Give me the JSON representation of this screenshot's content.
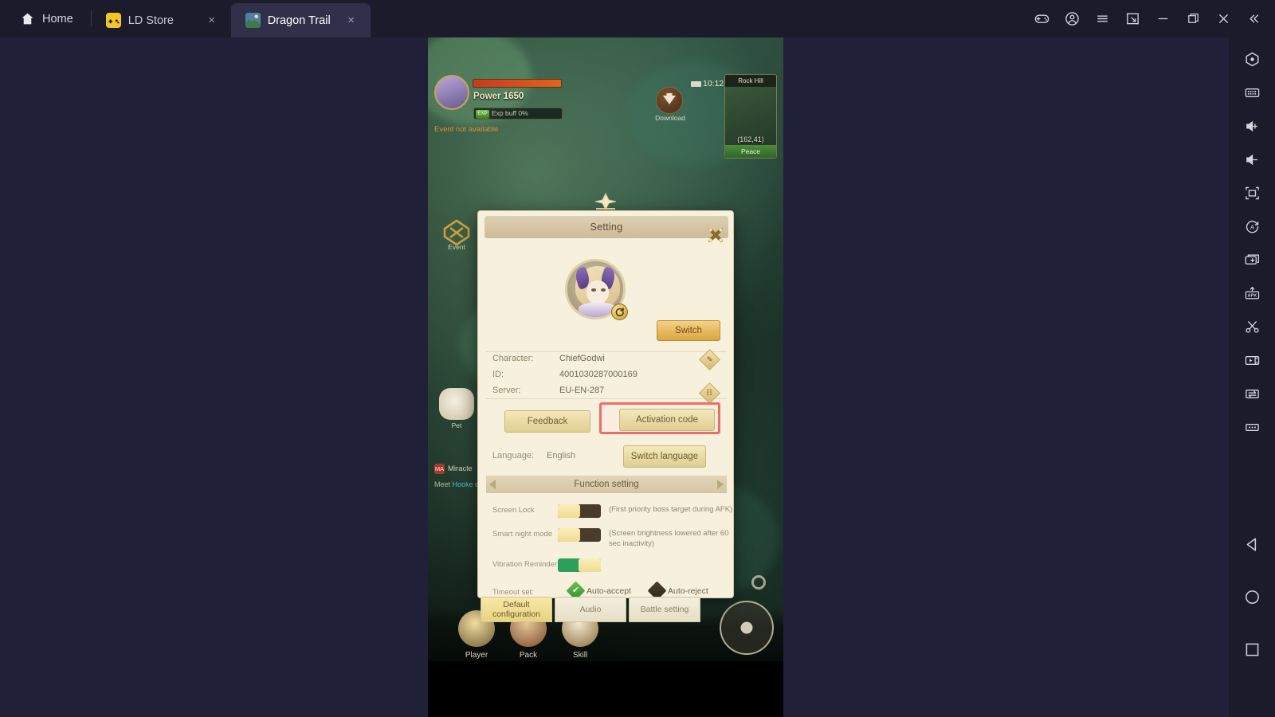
{
  "titlebar": {
    "home_label": "Home",
    "home_icon": "home-icon",
    "tabs": [
      {
        "label": "LD Store",
        "icon": "gamepad-icon",
        "close": "×",
        "active": false
      },
      {
        "label": "Dragon Trail",
        "icon": "game-thumbnail-icon",
        "close": "×",
        "active": true
      }
    ],
    "window_buttons": [
      {
        "name": "gamepad-icon"
      },
      {
        "name": "account-icon"
      },
      {
        "name": "menu-icon"
      },
      {
        "name": "shrink-window-icon"
      },
      {
        "name": "minimize-icon"
      },
      {
        "name": "maximize-icon"
      },
      {
        "name": "close-icon"
      },
      {
        "name": "collapse-toolbar-icon"
      }
    ]
  },
  "toolbar": {
    "items": [
      {
        "name": "record-macro-icon"
      },
      {
        "name": "keyboard-mapping-icon"
      },
      {
        "name": "volume-up-icon"
      },
      {
        "name": "volume-down-icon"
      },
      {
        "name": "fullscreen-icon"
      },
      {
        "name": "auto-rotate-icon"
      },
      {
        "name": "multi-instance-icon"
      },
      {
        "name": "install-apk-icon"
      },
      {
        "name": "screenshot-icon"
      },
      {
        "name": "video-record-icon"
      },
      {
        "name": "file-transfer-icon"
      },
      {
        "name": "more-options-icon"
      }
    ],
    "nav": [
      {
        "name": "android-back-icon"
      },
      {
        "name": "android-home-icon"
      },
      {
        "name": "android-recents-icon"
      }
    ]
  },
  "game_hud": {
    "power_label": "Power",
    "power_value": "1650",
    "exp_chip": "EXP",
    "exp_text": "Exp buff 0%",
    "warning": "Event not available",
    "clock": "10:12",
    "download_label": "Download",
    "minimap_title": "Rock Hill",
    "minimap_coords": "(162,41)",
    "minimap_state": "Peace",
    "event_label": "Event",
    "pet_label": "Pet",
    "chat_name": "Miracle",
    "chat_badge": "MA",
    "chat_line2_prefix": "Meet ",
    "chat_line2_link": "Hooke",
    "chat_line2_suffix": " on...",
    "slots": [
      {
        "label": "Player"
      },
      {
        "label": "Pack"
      },
      {
        "label": "Skill"
      }
    ]
  },
  "dialog": {
    "title": "Setting",
    "close_icon": "close-icon",
    "avatar_refresh_icon": "refresh-icon",
    "switch_label": "Switch",
    "info": [
      {
        "key": "Character:",
        "value": "ChiefGodwi"
      },
      {
        "key": "ID:",
        "value": "4001030287000169"
      },
      {
        "key": "Server:",
        "value": "EU-EN-287"
      }
    ],
    "edit_icon_glyph": "✎",
    "copy_icon_glyph": "☷",
    "feedback_label": "Feedback",
    "activation_label": "Activation code",
    "highlight_color": "#ef6d63",
    "language_key": "Language:",
    "language_value": "English",
    "switch_language_label": "Switch language",
    "function_section_title": "Function setting",
    "function_rows": [
      {
        "label": "Screen Lock",
        "state": "off",
        "hint": "(First priority boss target during AFK)"
      },
      {
        "label": "Smart night mode",
        "state": "off",
        "hint": "(Screen brightness lowered after 60 sec inactivity)"
      },
      {
        "label": "Vibration Reminder",
        "state": "on",
        "hint": ""
      }
    ],
    "timeout_label": "Timeout set:",
    "timeout_options": [
      {
        "label": "Auto-accept",
        "selected": true,
        "glyph": "✔"
      },
      {
        "label": "Auto-reject",
        "selected": false,
        "glyph": ""
      }
    ],
    "tabs": [
      {
        "label": "Default configuration",
        "active": true
      },
      {
        "label": "Audio",
        "active": false
      },
      {
        "label": "Battle setting",
        "active": false
      }
    ]
  },
  "colors": {
    "app_background": "#202039",
    "titlebar": "#1b1b2c",
    "active_tab": "#30304a",
    "dialog_bg": "#f7f0dc",
    "gold_button": "#d9a541",
    "toggle_on": "#2aa05c",
    "highlight": "#ef6d63"
  }
}
